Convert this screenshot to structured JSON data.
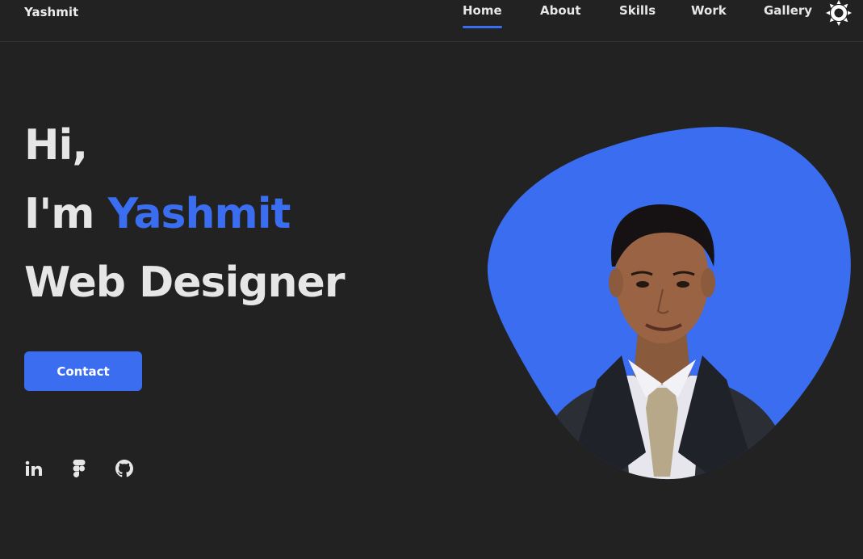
{
  "header": {
    "logo": "Yashmit",
    "nav": [
      {
        "label": "Home",
        "active": true
      },
      {
        "label": "About",
        "active": false
      },
      {
        "label": "Skills",
        "active": false
      },
      {
        "label": "Work",
        "active": false
      },
      {
        "label": "Gallery",
        "active": false
      }
    ],
    "theme_icon": "sun-icon"
  },
  "hero": {
    "line1": "Hi,",
    "line2_prefix": "I'm ",
    "line2_name": "Yashmit",
    "line3": "Web Designer",
    "contact_label": "Contact",
    "social": [
      "linkedin-icon",
      "figma-icon",
      "github-icon"
    ]
  },
  "colors": {
    "background": "#222222",
    "accent": "#3a6df0",
    "text": "#e6e6e6"
  }
}
